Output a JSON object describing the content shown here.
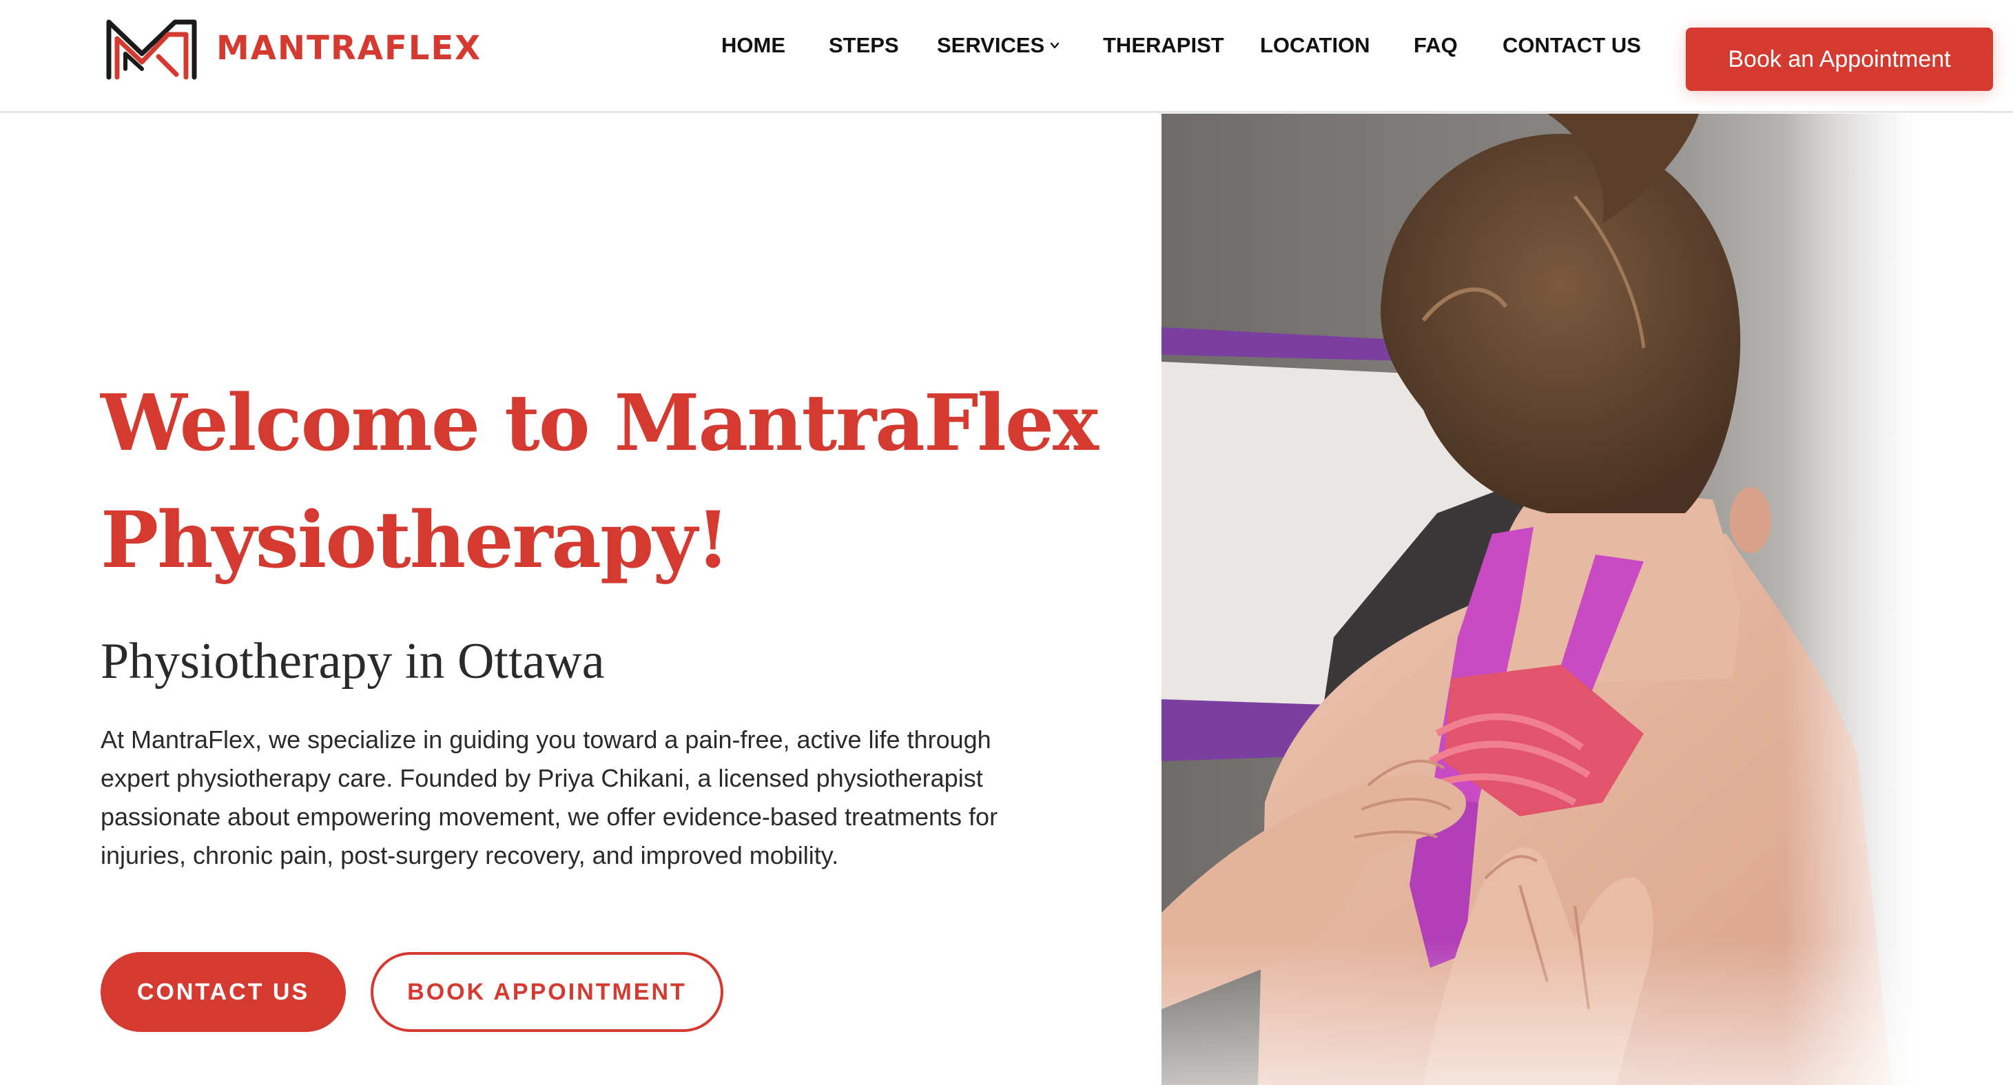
{
  "brand": {
    "name": "MANTRAFLEX",
    "color": "#d43a30",
    "logo_icon": "mantraflex-m-logo-icon"
  },
  "nav": {
    "items": [
      {
        "label": "HOME"
      },
      {
        "label": "STEPS"
      },
      {
        "label": "SERVICES",
        "icon": "chevron-down-icon"
      },
      {
        "label": "THERAPIST"
      },
      {
        "label": "LOCATION"
      },
      {
        "label": "FAQ"
      },
      {
        "label": "CONTACT US"
      }
    ],
    "book_button": "Book an Appointment"
  },
  "hero": {
    "title_line1": "Welcome to MantraFlex",
    "title_line2": "Physiotherapy!",
    "subtitle": "Physiotherapy in Ottawa",
    "description": "At MantraFlex, we specialize in guiding you toward a pain-free, active life through expert physiotherapy care. Founded by Priya Chikani, a licensed physiotherapist passionate about empowering movement, we offer evidence-based treatments for injuries, chronic pain, post-surgery recovery, and improved mobility.",
    "contact_button": "CONTACT US",
    "book_button": "BOOK APPOINTMENT",
    "image": "physiotherapist-applying-kinesio-tape-to-neck-photo"
  }
}
